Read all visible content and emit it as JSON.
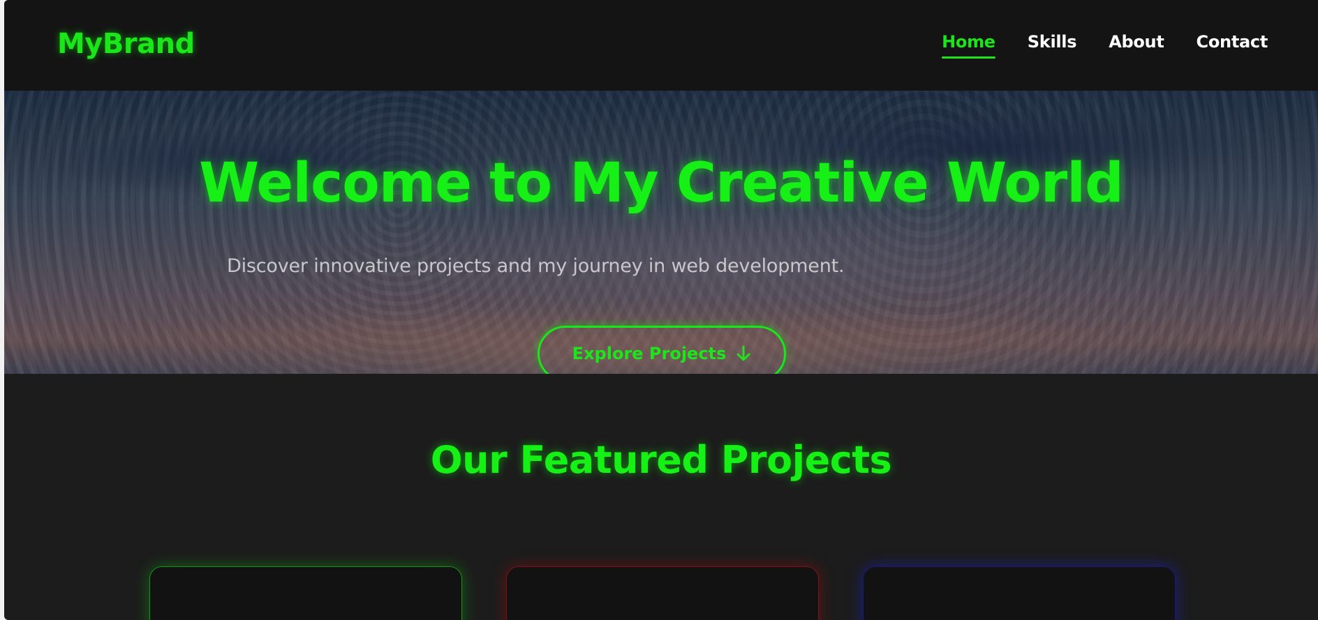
{
  "header": {
    "brand": "MyBrand",
    "nav": [
      {
        "label": "Home",
        "active": true
      },
      {
        "label": "Skills",
        "active": false
      },
      {
        "label": "About",
        "active": false
      },
      {
        "label": "Contact",
        "active": false
      }
    ]
  },
  "hero": {
    "title": "Welcome to My Creative World",
    "subtitle": "Discover innovative projects and my journey in web development.",
    "button_label": "Explore Projects",
    "button_icon": "arrow-down-icon"
  },
  "featured": {
    "title": "Our Featured Projects",
    "cards": [
      {
        "accent": "green",
        "color": "#1ae61a"
      },
      {
        "accent": "red",
        "color": "#e61a1a"
      },
      {
        "accent": "blue",
        "color": "#1a1aff"
      }
    ]
  },
  "colors": {
    "accent": "#1ae61a",
    "background": "#1c1c1c",
    "header_background": "#141414"
  }
}
